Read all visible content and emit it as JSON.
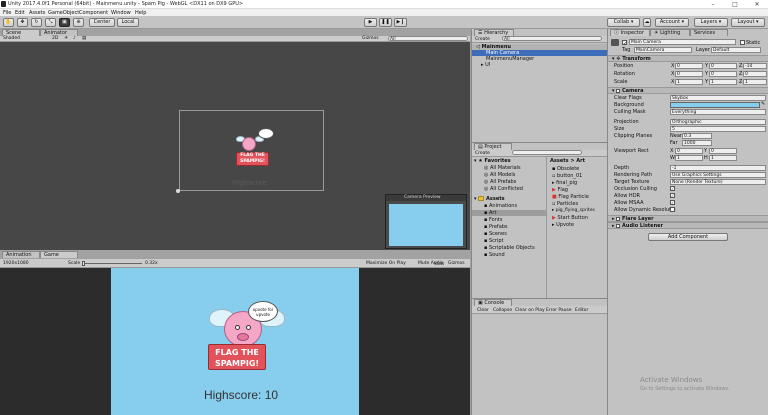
{
  "window": {
    "title": "Unity 2017.4.0f1 Personal (64bit) - Mainmenu.unity - Spam Pig - WebGL <DX11 on DX9 GPU>",
    "min_icon": "minimize-icon",
    "max_icon": "maximize-icon",
    "close_icon": "close-icon"
  },
  "menu": [
    "File",
    "Edit",
    "Assets",
    "GameObject",
    "Component",
    "Window",
    "Help"
  ],
  "toolbar": {
    "center": "Center",
    "local": "Local",
    "collab": "Collab",
    "account": "Account",
    "layers": "Layers",
    "layout": "Layout"
  },
  "scene": {
    "tab_scene": "Scene",
    "tab_animator": "Animator",
    "shaded": "Shaded",
    "mode2d": "2D",
    "gizmos": "Gizmos",
    "search_placeholder": "All",
    "highscore_ghost": "Highscore",
    "preview_title": "Camera Preview"
  },
  "game": {
    "tab_animation": "Animation",
    "tab_game": "Game",
    "resolution": "1920x1080",
    "scale_label": "Scale",
    "scale_value": "0.32x",
    "maximize": "Maximize On Play",
    "mute": "Mute Audio",
    "stats": "Stats",
    "gizmos": "Gizmos",
    "bubble_text": "upvote for upvote",
    "button_text_1": "FLAG THE",
    "button_text_2": "SPAMPIG!",
    "highscore": "Highscore: 10",
    "bg_color": "#87cded"
  },
  "hierarchy": {
    "tab": "Hierarchy",
    "create": "Create",
    "search_placeholder": "All",
    "scene_name": "Mainmenu",
    "items": [
      "Main Camera",
      "MainmenuManager",
      "UI"
    ]
  },
  "project": {
    "tab": "Project",
    "create": "Create",
    "favorites_label": "Favorites",
    "favorites": [
      "All Materials",
      "All Models",
      "All Prefabs",
      "All Conflicted"
    ],
    "assets_label": "Assets",
    "folders": [
      "Animations",
      "Art",
      "Fonts",
      "Prefabs",
      "Scenes",
      "Script",
      "Scriptable Objects",
      "Sound"
    ],
    "breadcrumb": "Assets > Art",
    "files": [
      "Obsolete",
      "button_01",
      "final_pig",
      "Flag",
      "Flag Particle",
      "Particles",
      "pig_flying_sprites",
      "Start Button",
      "Upvote"
    ]
  },
  "console": {
    "tab": "Console",
    "buttons": [
      "Clear",
      "Collapse",
      "Clear on Play",
      "Error Pause",
      "Editor"
    ]
  },
  "inspector": {
    "tabs": [
      "Inspector",
      "Lighting",
      "Services"
    ],
    "object_name": "Main Camera",
    "static_label": "Static",
    "tag_label": "Tag",
    "tag_value": "MainCamera",
    "layer_label": "Layer",
    "layer_value": "Default",
    "transform": {
      "header": "Transform",
      "rows": [
        {
          "label": "Position",
          "x": "0",
          "y": "0",
          "z": "-10"
        },
        {
          "label": "Rotation",
          "x": "0",
          "y": "0",
          "z": "0"
        },
        {
          "label": "Scale",
          "x": "1",
          "y": "1",
          "z": "1"
        }
      ]
    },
    "camera": {
      "header": "Camera",
      "clear_flags_label": "Clear Flags",
      "clear_flags": "Skybox",
      "background_label": "Background",
      "background_color": "#87cded",
      "culling_mask_label": "Culling Mask",
      "culling_mask": "Everything",
      "projection_label": "Projection",
      "projection": "Orthographic",
      "size_label": "Size",
      "size": "5",
      "clipping_label": "Clipping Planes",
      "near_label": "Near",
      "near": "0.3",
      "far_label": "Far",
      "far": "1000",
      "viewport_label": "Viewport Rect",
      "vx": "0",
      "vy": "0",
      "vw": "1",
      "vh": "1",
      "depth_label": "Depth",
      "depth": "-1",
      "rendering_path_label": "Rendering Path",
      "rendering_path": "Use Graphics Settings",
      "target_texture_label": "Target Texture",
      "target_texture": "None (Render Texture)",
      "occlusion_label": "Occlusion Culling",
      "hdr_label": "Allow HDR",
      "msaa_label": "Allow MSAA",
      "dynres_label": "Allow Dynamic Resolutio"
    },
    "flare_layer": "Flare Layer",
    "audio_listener": "Audio Listener",
    "add_component": "Add Component"
  },
  "watermark": {
    "line1": "Activate Windows",
    "line2": "Go to Settings to activate Windows."
  }
}
